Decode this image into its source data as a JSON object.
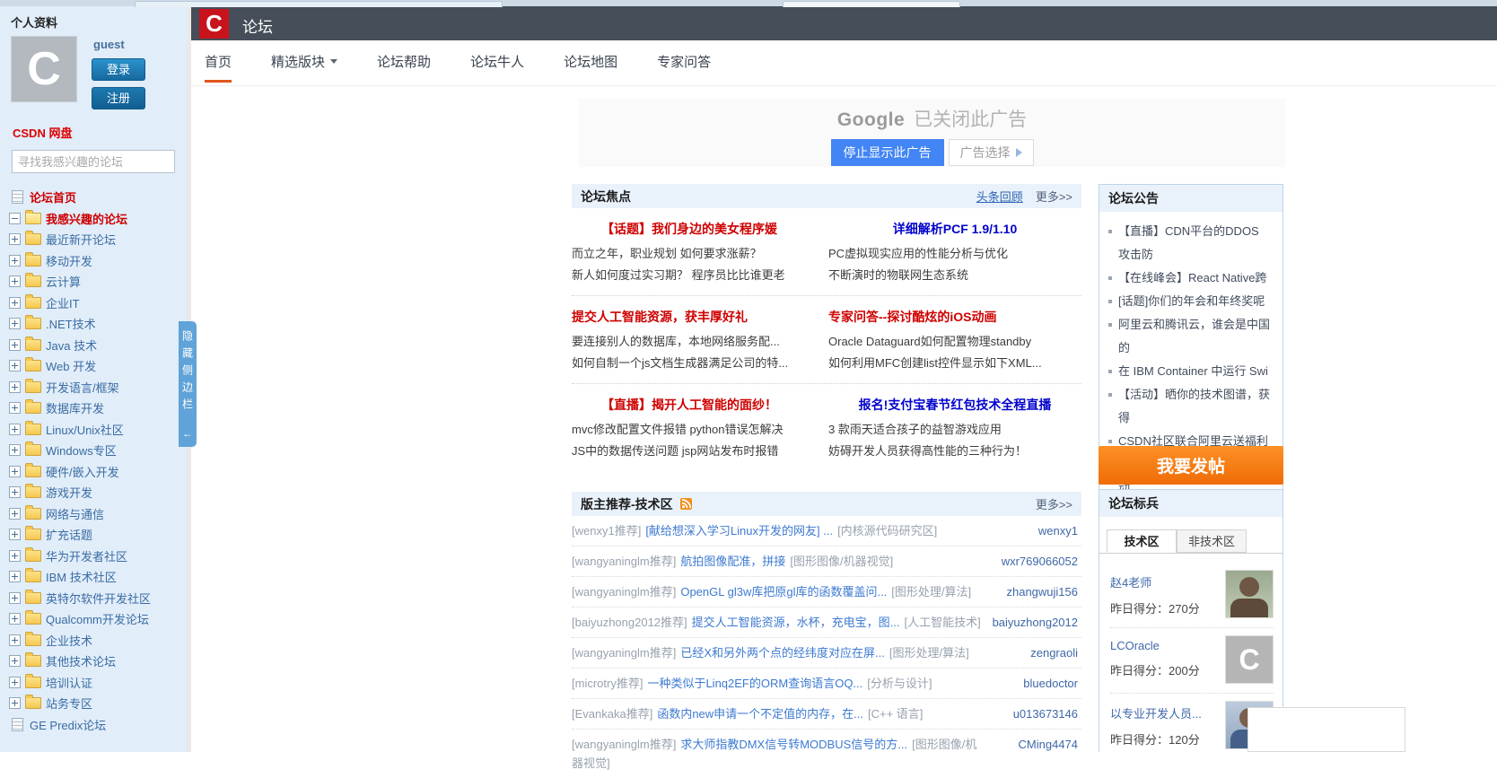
{
  "colors": {
    "logo_red": "#c8131c",
    "header_dark": "#454e59",
    "nav_active_orange": "#e0551e",
    "sidebar_bg": "#e1edf9",
    "section_header_bg": "#e9f2fb",
    "headline_red": "#cf0000",
    "headline_blue": "#0202cc",
    "link_blue": "#3d7ad1",
    "post_button_orange": "#f06c06",
    "google_blue": "#4285f4",
    "collapse_tab_blue": "#60a3d8"
  },
  "icons": {
    "expand": "plus-box",
    "collapse": "minus-box",
    "folder": "yellow-folder",
    "document": "document",
    "rss": "rss-feed",
    "dropdown": "caret-down",
    "adchoices": "play-triangle",
    "back_arrow": "←"
  },
  "profile": {
    "section_title": "个人资料",
    "username": "guest",
    "login_button": "登录",
    "register_button": "注册",
    "avatar_letter": "C",
    "netdisk_link": "CSDN 网盘",
    "search_placeholder": "寻找我感兴趣的论坛"
  },
  "sidebar": {
    "collapse_tab": {
      "label": "隐藏侧边栏",
      "arrow": "←"
    },
    "items": [
      {
        "label": "论坛首页"
      },
      {
        "label": "我感兴趣的论坛"
      },
      {
        "label": "最近新开论坛"
      },
      {
        "label": "移动开发"
      },
      {
        "label": "云计算"
      },
      {
        "label": "企业IT"
      },
      {
        "label": ".NET技术"
      },
      {
        "label": "Java 技术"
      },
      {
        "label": "Web 开发"
      },
      {
        "label": "开发语言/框架"
      },
      {
        "label": "数据库开发"
      },
      {
        "label": "Linux/Unix社区"
      },
      {
        "label": "Windows专区"
      },
      {
        "label": "硬件/嵌入开发"
      },
      {
        "label": "游戏开发"
      },
      {
        "label": "网络与通信"
      },
      {
        "label": "扩充话题"
      },
      {
        "label": "华为开发者社区"
      },
      {
        "label": "IBM 技术社区"
      },
      {
        "label": "英特尔软件开发社区"
      },
      {
        "label": "Qualcomm开发论坛"
      },
      {
        "label": "企业技术"
      },
      {
        "label": "其他技术论坛"
      },
      {
        "label": "培训认证"
      },
      {
        "label": "站务专区"
      },
      {
        "label": "GE Predix论坛"
      }
    ]
  },
  "header": {
    "logo_letter": "C",
    "title": "论坛"
  },
  "nav": {
    "items": [
      {
        "label": "首页"
      },
      {
        "label": "精选版块"
      },
      {
        "label": "论坛帮助"
      },
      {
        "label": "论坛牛人"
      },
      {
        "label": "论坛地图"
      },
      {
        "label": "专家问答"
      }
    ]
  },
  "ad": {
    "brand": "Google",
    "status_text": "已关闭此广告",
    "stop_button": "停止显示此广告",
    "choices_button": "广告选择"
  },
  "focus": {
    "title": "论坛焦点",
    "headline_review_link": "头条回顾",
    "more_link": "更多>>",
    "groups": [
      {
        "left": {
          "headline": "【话题】我们身边的美女程序媛",
          "lines": [
            "而立之年，职业规划 如何要求涨薪？",
            "新人如何度过实习期？ 程序员比比谁更老"
          ]
        },
        "right": {
          "headline": "详细解析PCF 1.9/1.10",
          "lines": [
            "PC虚拟现实应用的性能分析与优化",
            "不断演时的物联网生态系统"
          ]
        }
      },
      {
        "left": {
          "headline": "提交人工智能资源，获丰厚好礼",
          "lines": [
            "要连接别人的数据库，本地网络服务配...",
            "如何自制一个js文档生成器满足公司的特..."
          ]
        },
        "right": {
          "headline": "专家问答--探讨酷炫的iOS动画",
          "lines": [
            "Oracle Dataguard如何配置物理standby",
            "如何利用MFC创建list控件显示如下XML..."
          ]
        }
      },
      {
        "left": {
          "headline": "【直播】揭开人工智能的面纱！",
          "lines": [
            "mvc修改配置文件报错  python错误怎解决",
            "JS中的数据传送问题  jsp网站发布时报错"
          ]
        },
        "right": {
          "headline": "报名!支付宝春节红包技术全程直播",
          "lines": [
            "3 款雨天适合孩子的益智游戏应用",
            "妨碍开发人员获得高性能的三种行为！"
          ]
        }
      }
    ]
  },
  "recommend": {
    "title": "版主推荐-技术区",
    "more_link": "更多>>",
    "rows": [
      {
        "rec": "[wenxy1推荐]",
        "title": "[献给想深入学习Linux开发的网友] ...",
        "cat": "[内核源代码研究区]",
        "user": "wenxy1"
      },
      {
        "rec": "[wangyaninglm推荐]",
        "title": "航拍图像配准，拼接",
        "cat": "[图形图像/机器视觉]",
        "user": "wxr769066052"
      },
      {
        "rec": "[wangyaninglm推荐]",
        "title": "OpenGL gl3w库把原gl库的函数覆盖问...",
        "cat": "[图形处理/算法]",
        "user": "zhangwuji156"
      },
      {
        "rec": "[baiyuzhong2012推荐]",
        "title": "提交人工智能资源，水杯，充电宝，图...",
        "cat": "[人工智能技术]",
        "user": "baiyuzhong2012"
      },
      {
        "rec": "[wangyaninglm推荐]",
        "title": "已经X和另外两个点的经纬度对应在屏...",
        "cat": "[图形处理/算法]",
        "user": "zengraoli"
      },
      {
        "rec": "[microtry推荐]",
        "title": "一种类似于Linq2EF的ORM查询语言OQ...",
        "cat": "[分析与设计]",
        "user": "bluedoctor"
      },
      {
        "rec": "[Evankaka推荐]",
        "title": "函数内new申请一个不定值的内存，在...",
        "cat": "[C++ 语言]",
        "user": "u013673146"
      },
      {
        "rec": "[wangyaninglm推荐]",
        "title": "求大师指教DMX信号转MODBUS信号的方...",
        "cat": "[图形图像/机器视觉]",
        "user": "CMing4474"
      }
    ]
  },
  "announcements": {
    "title": "论坛公告",
    "items": [
      "【直播】CDN平台的DDOS攻击防",
      "【在线峰会】React Native跨",
      "[话题]你们的年会和年终奖呢",
      "阿里云和腾讯云，谁会是中国的",
      "在 IBM Container 中运行 Swi",
      "【活动】晒你的技术图谱，获得",
      "CSDN社区联合阿里云送福利",
      "没想到还有程序员专场观影活动"
    ]
  },
  "post_button_label": "我要发帖",
  "pacesetter": {
    "title": "论坛标兵",
    "tabs": [
      {
        "label": "技术区"
      },
      {
        "label": "非技术区"
      }
    ],
    "score_label": "昨日得分：",
    "users": [
      {
        "name": "赵4老师",
        "score": "270分"
      },
      {
        "name": "LCOracle",
        "score": "200分",
        "avatar_letter": "C"
      },
      {
        "name": "以专业开发人员...",
        "score": "120分"
      }
    ]
  }
}
